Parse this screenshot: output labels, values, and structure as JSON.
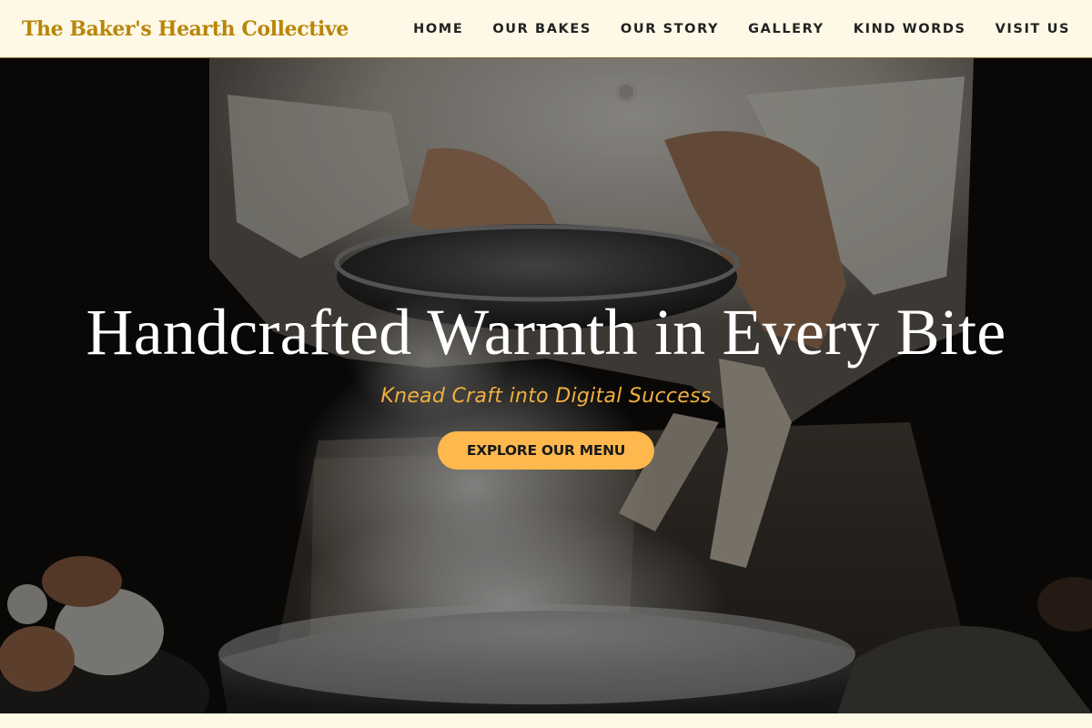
{
  "brand": {
    "name": "The Baker's Hearth Collective"
  },
  "nav": {
    "items": [
      {
        "label": "HOME"
      },
      {
        "label": "OUR BAKES"
      },
      {
        "label": "OUR STORY"
      },
      {
        "label": "GALLERY"
      },
      {
        "label": "KIND WORDS"
      },
      {
        "label": "VISIT US"
      }
    ]
  },
  "hero": {
    "title": "Handcrafted Warmth in Every Bite",
    "subtitle": "Knead Craft into Digital Success",
    "cta_label": "EXPLORE OUR MENU",
    "image_description": "baker sifting flour into bowl"
  },
  "colors": {
    "nav_bg": "#fef9e7",
    "brand": "#b8860b",
    "accent_text": "#f0b040",
    "cta_bg": "#ffb84d"
  }
}
